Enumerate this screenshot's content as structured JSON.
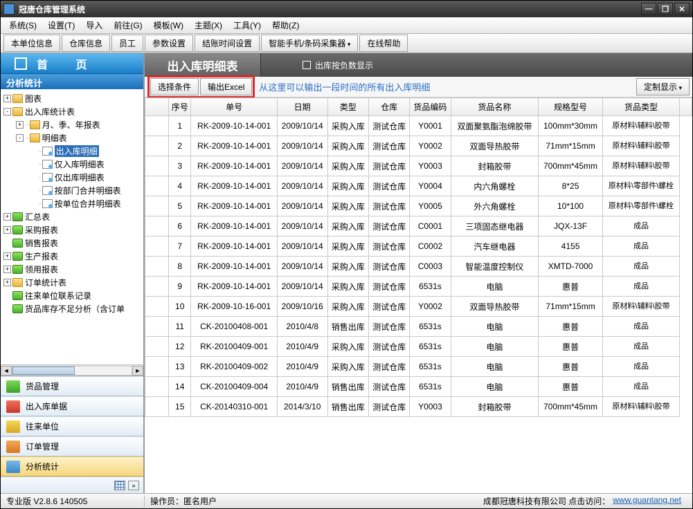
{
  "window": {
    "title": "冠唐仓库管理系统"
  },
  "menu": [
    "系统(S)",
    "设置(T)",
    "导入",
    "前往(G)",
    "模板(W)",
    "主题(X)",
    "工具(Y)",
    "帮助(Z)"
  ],
  "toolbar": [
    {
      "label": "本单位信息",
      "dd": false
    },
    {
      "label": "仓库信息",
      "dd": false
    },
    {
      "label": "员工",
      "dd": false
    },
    {
      "label": "参数设置",
      "dd": false
    },
    {
      "label": "结账时间设置",
      "dd": false
    },
    {
      "label": "智能手机/条码采集器",
      "dd": true
    },
    {
      "label": "在线帮助",
      "dd": false
    }
  ],
  "home_tab": "首    页",
  "sidebar_section": "分析统计",
  "tree": [
    {
      "lvl": 0,
      "tg": "+",
      "ic": "folder",
      "lbl": "图表"
    },
    {
      "lvl": 0,
      "tg": "-",
      "ic": "folder",
      "lbl": "出入库统计表"
    },
    {
      "lvl": 1,
      "tg": "+",
      "ic": "folder",
      "lbl": "月、季、年报表"
    },
    {
      "lvl": 1,
      "tg": "-",
      "ic": "folder",
      "lbl": "明细表"
    },
    {
      "lvl": 2,
      "tg": "",
      "ic": "page",
      "lbl": "出入库明细",
      "sel": true
    },
    {
      "lvl": 2,
      "tg": "",
      "ic": "page",
      "lbl": "仅入库明细表"
    },
    {
      "lvl": 2,
      "tg": "",
      "ic": "page",
      "lbl": "仅出库明细表"
    },
    {
      "lvl": 2,
      "tg": "",
      "ic": "page",
      "lbl": "按部门合并明细表"
    },
    {
      "lvl": 2,
      "tg": "",
      "ic": "page",
      "lbl": "按单位合并明细表"
    },
    {
      "lvl": 0,
      "tg": "+",
      "ic": "green",
      "lbl": "汇总表"
    },
    {
      "lvl": 0,
      "tg": "+",
      "ic": "green",
      "lbl": "采购报表"
    },
    {
      "lvl": 0,
      "tg": "",
      "ic": "green",
      "lbl": "销售报表"
    },
    {
      "lvl": 0,
      "tg": "+",
      "ic": "green",
      "lbl": "生产报表"
    },
    {
      "lvl": 0,
      "tg": "+",
      "ic": "green",
      "lbl": "领用报表"
    },
    {
      "lvl": 0,
      "tg": "+",
      "ic": "folder",
      "lbl": "订单统计表"
    },
    {
      "lvl": 0,
      "tg": "",
      "ic": "green",
      "lbl": "往来单位联系记录"
    },
    {
      "lvl": 0,
      "tg": "",
      "ic": "green",
      "lbl": "货品库存不足分析（含订单"
    }
  ],
  "nav": [
    {
      "lbl": "货品管理",
      "ic": "ni-g"
    },
    {
      "lbl": "出入库单据",
      "ic": "ni-r"
    },
    {
      "lbl": "往来单位",
      "ic": "ni-y"
    },
    {
      "lbl": "订单管理",
      "ic": "ni-o"
    },
    {
      "lbl": "分析统计",
      "ic": "ni-b",
      "active": true
    }
  ],
  "content": {
    "title": "出入库明细表",
    "checkbox": "出库按负数显示",
    "btn_filter": "选择条件",
    "btn_export": "输出Excel",
    "hint": "从这里可以输出一段时间的所有出入库明细",
    "btn_custom": "定制显示"
  },
  "columns": [
    "序号",
    "单号",
    "日期",
    "类型",
    "仓库",
    "货品编码",
    "货品名称",
    "规格型号",
    "货品类型"
  ],
  "rows": [
    [
      "1",
      "RK-2009-10-14-001",
      "2009/10/14",
      "采购入库",
      "测试仓库",
      "Y0001",
      "双面聚氨酯泡绵胶带",
      "100mm*30mm",
      "原材料\\辅料\\胶带"
    ],
    [
      "2",
      "RK-2009-10-14-001",
      "2009/10/14",
      "采购入库",
      "测试仓库",
      "Y0002",
      "双面导热胶带",
      "71mm*15mm",
      "原材料\\辅料\\胶带"
    ],
    [
      "3",
      "RK-2009-10-14-001",
      "2009/10/14",
      "采购入库",
      "测试仓库",
      "Y0003",
      "封箱胶带",
      "700mm*45mm",
      "原材料\\辅料\\胶带"
    ],
    [
      "4",
      "RK-2009-10-14-001",
      "2009/10/14",
      "采购入库",
      "测试仓库",
      "Y0004",
      "内六角螺栓",
      "8*25",
      "原材料\\零部件\\螺栓"
    ],
    [
      "5",
      "RK-2009-10-14-001",
      "2009/10/14",
      "采购入库",
      "测试仓库",
      "Y0005",
      "外六角螺栓",
      "10*100",
      "原材料\\零部件\\螺栓"
    ],
    [
      "6",
      "RK-2009-10-14-001",
      "2009/10/14",
      "采购入库",
      "测试仓库",
      "C0001",
      "三项固态继电器",
      "JQX-13F",
      "成品"
    ],
    [
      "7",
      "RK-2009-10-14-001",
      "2009/10/14",
      "采购入库",
      "测试仓库",
      "C0002",
      "汽车继电器",
      "4155",
      "成品"
    ],
    [
      "8",
      "RK-2009-10-14-001",
      "2009/10/14",
      "采购入库",
      "测试仓库",
      "C0003",
      "智能温度控制仪",
      "XMTD-7000",
      "成品"
    ],
    [
      "9",
      "RK-2009-10-14-001",
      "2009/10/14",
      "采购入库",
      "测试仓库",
      "6531s",
      "电脑",
      "惠普",
      "成品"
    ],
    [
      "10",
      "RK-2009-10-16-001",
      "2009/10/16",
      "采购入库",
      "测试仓库",
      "Y0002",
      "双面导热胶带",
      "71mm*15mm",
      "原材料\\辅料\\胶带"
    ],
    [
      "11",
      "CK-20100408-001",
      "2010/4/8",
      "销售出库",
      "测试仓库",
      "6531s",
      "电脑",
      "惠普",
      "成品"
    ],
    [
      "12",
      "RK-20100409-001",
      "2010/4/9",
      "采购入库",
      "测试仓库",
      "6531s",
      "电脑",
      "惠普",
      "成品"
    ],
    [
      "13",
      "RK-20100409-002",
      "2010/4/9",
      "采购入库",
      "测试仓库",
      "6531s",
      "电脑",
      "惠普",
      "成品"
    ],
    [
      "14",
      "CK-20100409-004",
      "2010/4/9",
      "销售出库",
      "测试仓库",
      "6531s",
      "电脑",
      "惠普",
      "成品"
    ],
    [
      "15",
      "CK-20140310-001",
      "2014/3/10",
      "销售出库",
      "测试仓库",
      "Y0003",
      "封箱胶带",
      "700mm*45mm",
      "原材料\\辅料\\胶带"
    ]
  ],
  "status": {
    "version": "专业版  V2.8.6 140505",
    "operator_lbl": "操作员：",
    "operator": "匿名用户",
    "company": "成都冠唐科技有限公司 点击访问：",
    "url": "www.guantang.net"
  }
}
